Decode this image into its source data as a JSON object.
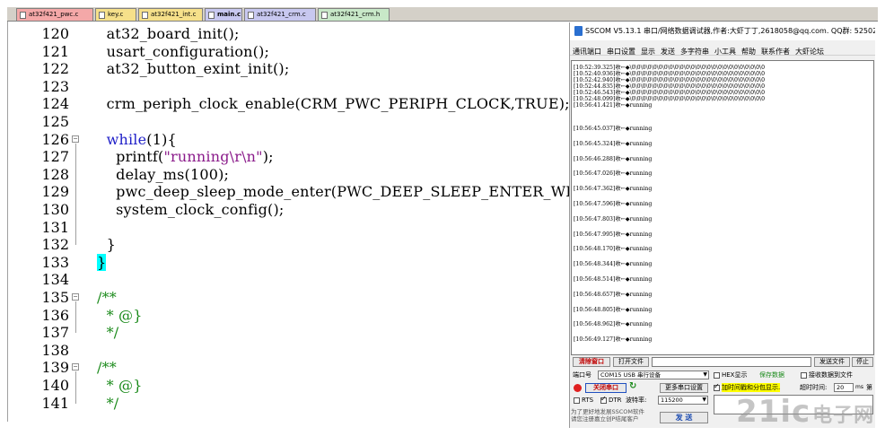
{
  "tabs": [
    {
      "label": "at32f421_pwc.c",
      "color": "#f4a8a8",
      "active": false
    },
    {
      "label": "key.c",
      "color": "#f6e08a",
      "active": false
    },
    {
      "label": "at32f421_int.c",
      "color": "#f6e08a",
      "active": false
    },
    {
      "label": "main.c",
      "color": "#c8c8f0",
      "active": true
    },
    {
      "label": "at32f421_crm.c",
      "color": "#c8c8f0",
      "active": false
    },
    {
      "label": "at32f421_crm.h",
      "color": "#c8e8c8",
      "active": false
    }
  ],
  "editor": {
    "lines": [
      {
        "num": "120",
        "fold": "",
        "parts": [
          {
            "t": "  at32_board_init();",
            "c": ""
          }
        ]
      },
      {
        "num": "121",
        "fold": "",
        "parts": [
          {
            "t": "  usart_configuration();",
            "c": ""
          }
        ]
      },
      {
        "num": "122",
        "fold": "",
        "parts": [
          {
            "t": "  at32_button_exint_init();",
            "c": ""
          }
        ]
      },
      {
        "num": "123",
        "fold": "",
        "parts": []
      },
      {
        "num": "124",
        "fold": "",
        "parts": [
          {
            "t": "  crm_periph_clock_enable(CRM_PWC_PERIPH_CLOCK,TRUE);",
            "c": ""
          }
        ]
      },
      {
        "num": "125",
        "fold": "",
        "parts": []
      },
      {
        "num": "126",
        "fold": "−",
        "parts": [
          {
            "t": "  ",
            "c": ""
          },
          {
            "t": "while",
            "c": "kw"
          },
          {
            "t": "(1){",
            "c": ""
          }
        ]
      },
      {
        "num": "127",
        "fold": "",
        "parts": [
          {
            "t": "    printf(",
            "c": ""
          },
          {
            "t": "\"running\\r\\n\"",
            "c": "str"
          },
          {
            "t": ");",
            "c": ""
          }
        ]
      },
      {
        "num": "128",
        "fold": "",
        "parts": [
          {
            "t": "    delay_ms(100);",
            "c": ""
          }
        ]
      },
      {
        "num": "129",
        "fold": "",
        "parts": [
          {
            "t": "    pwc_deep_sleep_mode_enter(PWC_DEEP_SLEEP_ENTER_WFI);",
            "c": ""
          }
        ]
      },
      {
        "num": "130",
        "fold": "",
        "parts": [
          {
            "t": "    system_clock_config();",
            "c": ""
          }
        ]
      },
      {
        "num": "131",
        "fold": "",
        "parts": []
      },
      {
        "num": "132",
        "fold": "",
        "parts": [
          {
            "t": "  }",
            "c": ""
          }
        ]
      },
      {
        "num": "133",
        "fold": "",
        "parts": [
          {
            "t": "}",
            "c": "hl"
          }
        ]
      },
      {
        "num": "134",
        "fold": "",
        "parts": []
      },
      {
        "num": "135",
        "fold": "−",
        "parts": [
          {
            "t": "/**",
            "c": "com"
          }
        ]
      },
      {
        "num": "136",
        "fold": "",
        "parts": [
          {
            "t": "  * @}",
            "c": "com"
          }
        ]
      },
      {
        "num": "137",
        "fold": "",
        "parts": [
          {
            "t": "  */",
            "c": "com"
          }
        ]
      },
      {
        "num": "138",
        "fold": "",
        "parts": []
      },
      {
        "num": "139",
        "fold": "−",
        "parts": [
          {
            "t": "/**",
            "c": "com"
          }
        ]
      },
      {
        "num": "140",
        "fold": "",
        "parts": [
          {
            "t": "  * @}",
            "c": "com"
          }
        ]
      },
      {
        "num": "141",
        "fold": "",
        "parts": [
          {
            "t": "  */",
            "c": "com"
          }
        ]
      }
    ]
  },
  "sscom": {
    "title": "SSCOM V5.13.1 串口/网络数据调试器,作者:大虾丁丁,2618058@qq.com. QQ群: 52502",
    "menu": [
      "通讯端口",
      "串口设置",
      "显示",
      "发送",
      "多字符串",
      "小工具",
      "帮助",
      "联系作者",
      "大虾论坛"
    ],
    "recv_dense": [
      "[10:52:39.325]收←◆\\0\\0\\0\\0\\0\\0\\0\\0\\0\\0\\0\\0\\0\\0\\0\\0\\0\\0\\0\\0\\0\\0\\0\\0\\0",
      "[10:52:40.936]收←◆\\0\\0\\0\\0\\0\\0\\0\\0\\0\\0\\0\\0\\0\\0\\0\\0\\0\\0\\0\\0\\0\\0\\0\\0\\0",
      "[10:52:42.940]收←◆\\0\\0\\0\\0\\0\\0\\0\\0\\0\\0\\0\\0\\0\\0\\0\\0\\0\\0\\0\\0\\0\\0\\0\\0\\0",
      "[10:52:44.835]收←◆\\0\\0\\0\\0\\0\\0\\0\\0\\0\\0\\0\\0\\0\\0\\0\\0\\0\\0\\0\\0\\0\\0\\0\\0\\0",
      "[10:52:46.543]收←◆\\0\\0\\0\\0\\0\\0\\0\\0\\0\\0\\0\\0\\0\\0\\0\\0\\0\\0\\0\\0\\0\\0\\0\\0\\0",
      "[10:52:48.099]收←◆\\0\\0\\0\\0\\0\\0\\0\\0\\0\\0\\0\\0\\0\\0\\0\\0\\0\\0\\0\\0\\0\\0\\0\\0\\0",
      "[10:56:41.421]收←◆running"
    ],
    "recv_running": [
      "[10:56:45.037]收←◆running",
      "[10:56:45.324]收←◆running",
      "[10:56:46.288]收←◆running",
      "[10:56:47.026]收←◆running",
      "[10:56:47.362]收←◆running",
      "[10:56:47.596]收←◆running",
      "[10:56:47.803]收←◆running",
      "[10:56:47.995]收←◆running",
      "[10:56:48.170]收←◆running",
      "[10:56:48.344]收←◆running",
      "[10:56:48.514]收←◆running",
      "[10:56:48.657]收←◆running",
      "[10:56:48.805]收←◆running",
      "[10:56:48.962]收←◆running",
      "[10:56:49.127]收←◆running"
    ],
    "clear_btn": "清除窗口",
    "open_file_btn": "打开文件",
    "send_file_btn": "发送文件",
    "stop_btn": "停止",
    "port_label": "端口号",
    "port_value": "COM15 USB 串行设备",
    "hex_show": "HEX显示",
    "save_data": "保存数据",
    "recv_to_file": "接收数据到文件",
    "close_port_btn": "关闭串口",
    "more_settings": "更多串口设置",
    "timestamp_label": "加时间戳和分包显示.",
    "timeout_label": "超时时间:",
    "timeout_value": "20",
    "timeout_unit": "ms",
    "timeout_tail": "第",
    "rts_label": "RTS",
    "dtr_label": "DTR",
    "baud_label": "波特率:",
    "baud_value": "115200",
    "promo": "为了更好地发展SSCOM软件",
    "promo2": "请您注册嘉立创P结尾客户",
    "send_btn": "发 送"
  },
  "watermark": {
    "logo": "21ic",
    "subtitle": "电子网"
  }
}
